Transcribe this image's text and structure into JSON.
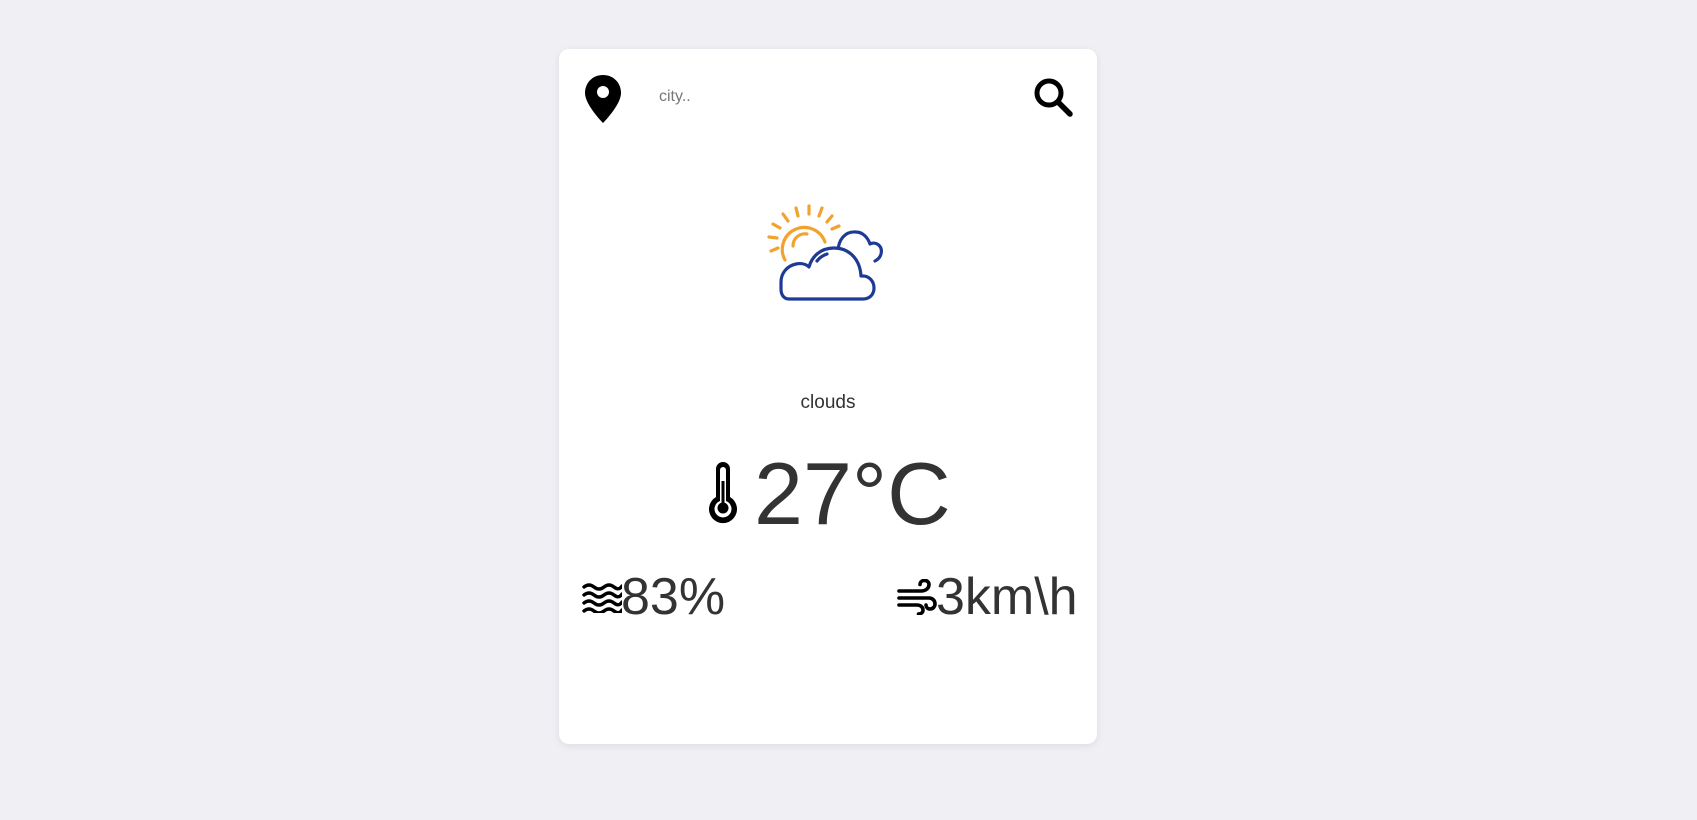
{
  "search": {
    "placeholder": "city..",
    "value": "",
    "location_icon": "map-pin-icon",
    "search_icon": "search-icon"
  },
  "weather": {
    "icon": "partly-cloudy-icon",
    "description": "clouds",
    "temperature": "27°C",
    "temperature_icon": "thermometer-icon",
    "humidity": "83%",
    "humidity_icon": "water-waves-icon",
    "wind": "3km\\h",
    "wind_icon": "wind-icon"
  },
  "colors": {
    "background": "#f0eff4",
    "card": "#ffffff",
    "text": "#333333",
    "sun": "#f2a22e",
    "cloud": "#1d3b96"
  }
}
